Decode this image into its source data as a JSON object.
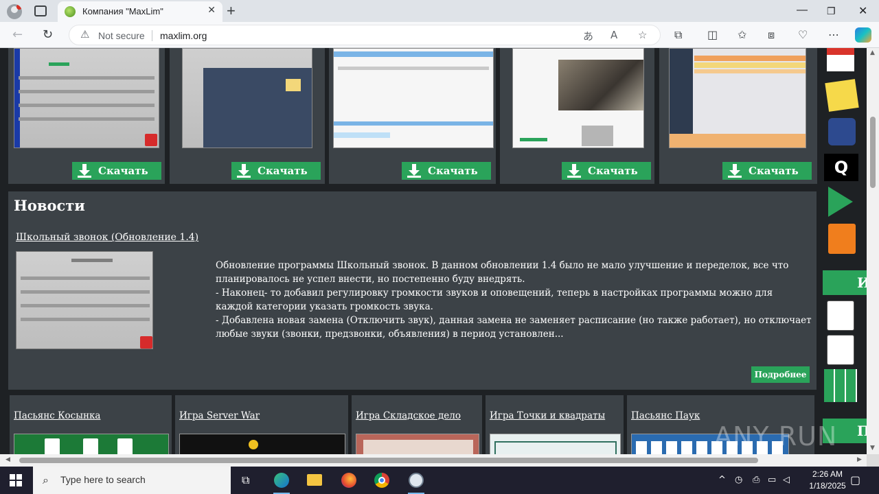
{
  "browser": {
    "tab_title": "Компания \"MaxLim\"",
    "not_secure": "Not secure",
    "url": "maxlim.org",
    "new_tab": "+",
    "close_tab": "✕"
  },
  "products": [
    {
      "download": "Скачать"
    },
    {
      "download": "Скачать"
    },
    {
      "download": "Скачать"
    },
    {
      "download": "Скачать"
    },
    {
      "download": "Скачать"
    }
  ],
  "news": {
    "heading": "Новости",
    "item_title": "Школьный звонок (Обновление 1.4)",
    "item_text_1": "Обновление программы Школьный звонок. В данном обновлении 1.4 было не мало улучшение и переделок, все что планировалось не успел внести, но постепенно буду внедрять.",
    "item_text_2": "- Наконец- то добавил регулировку громкости звуков и оповещений, теперь в настройках программы можно для каждой категории указать громкость звука.",
    "item_text_3": "- Добавлена новая замена (Отключить звук), данная замена не заменяет расписание (но также работает), но отключает любые звуки (звонки, предзвонки, объявления) в период установлен...",
    "more": "Подробнее"
  },
  "games": [
    {
      "title": "Пасьянс Косынка"
    },
    {
      "title": "Игра Server War"
    },
    {
      "title": "Игра Складское дело"
    },
    {
      "title": "Игра Точки и квадраты"
    },
    {
      "title": "Пасьянс Паук"
    }
  ],
  "sidebar": {
    "letter_q": "Q",
    "green_1": "И",
    "green_2": "П"
  },
  "watermark": "ANY RUN",
  "taskbar": {
    "search_placeholder": "Type here to search",
    "time": "2:26 AM",
    "date": "1/18/2025"
  },
  "colors": {
    "page_bg": "#1e2124",
    "card_bg": "#3c4247",
    "accent_green": "#2aa35a"
  }
}
